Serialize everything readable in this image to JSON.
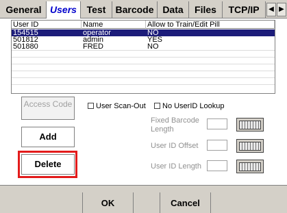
{
  "tabs": [
    {
      "label": "General"
    },
    {
      "label": "Users"
    },
    {
      "label": "Test"
    },
    {
      "label": "Barcode"
    },
    {
      "label": "Data"
    },
    {
      "label": "Files"
    },
    {
      "label": "TCP/IP"
    }
  ],
  "tab_nav": {
    "prev": "◀",
    "next": "▶"
  },
  "table": {
    "columns": [
      "User ID",
      "Name",
      "Allow to Train/Edit Pill"
    ],
    "rows": [
      {
        "user_id": "154515",
        "name": "operator",
        "allow": "NO",
        "selected": true
      },
      {
        "user_id": "501812",
        "name": "admin",
        "allow": "YES",
        "selected": false
      },
      {
        "user_id": "501880",
        "name": "FRED",
        "allow": "NO",
        "selected": false
      }
    ]
  },
  "buttons": {
    "access_code": "Access Code",
    "add": "Add",
    "delete": "Delete"
  },
  "checkboxes": {
    "user_scan_out": "User Scan-Out",
    "no_user_id_lookup": "No UserID Lookup"
  },
  "fields": {
    "fixed_barcode_length": "Fixed Barcode Length",
    "user_id_offset": "User ID Offset",
    "user_id_length": "User ID Length"
  },
  "bottom": {
    "ok": "OK",
    "cancel": "Cancel"
  },
  "colors": {
    "selection": "#1c1c7a",
    "active_tab_text": "#0000cc",
    "highlight": "#e31b1b"
  }
}
